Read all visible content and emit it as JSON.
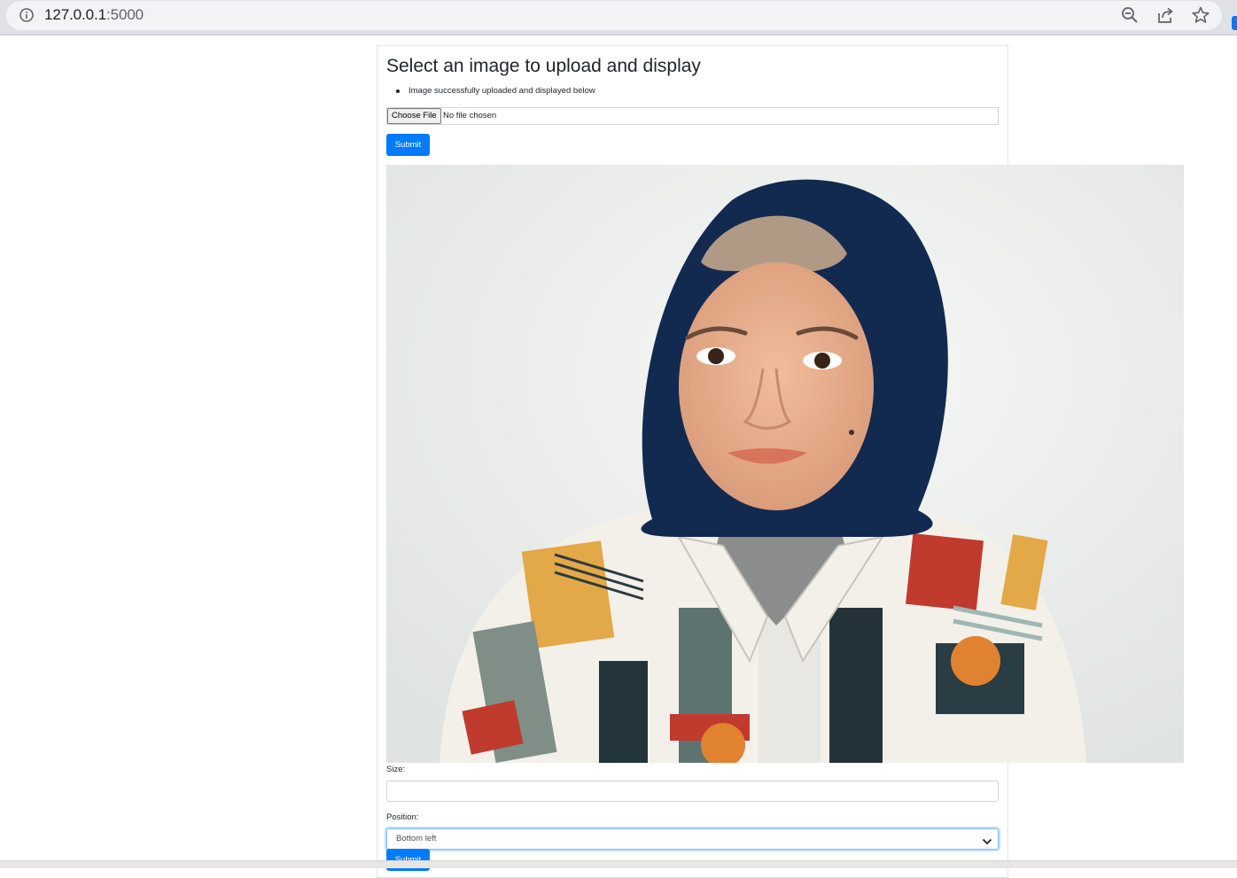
{
  "browser": {
    "url_host": "127.0.0.1",
    "url_port": ":5000",
    "icons": [
      "info-icon",
      "zoom-icon",
      "share-icon",
      "star-icon"
    ]
  },
  "page": {
    "title": "Select an image to upload and display",
    "flash_messages": [
      "Image successfully uploaded and displayed below"
    ],
    "file_input": {
      "button_label": "Choose File",
      "status": "No file chosen"
    },
    "submit_label": "Submit",
    "uploaded_image": {
      "description": "photo-of-woman-in-navy-hijab-and-patterned-shirt"
    },
    "size_field": {
      "label": "Size:",
      "value": ""
    },
    "position_field": {
      "label": "Position:",
      "selected": "Bottom left"
    },
    "submit_label_2": "Submit"
  },
  "colors": {
    "primary": "#007bff",
    "hijab": "#122a4f",
    "skin": "#e7ae8c"
  }
}
